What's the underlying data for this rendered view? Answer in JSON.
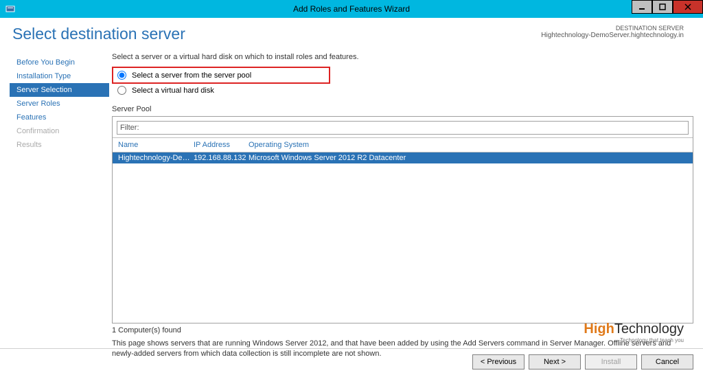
{
  "titlebar": {
    "title": "Add Roles and Features Wizard"
  },
  "header": {
    "pageTitle": "Select destination server",
    "destLabel": "DESTINATION SERVER",
    "destValue": "Hightechnology-DemoServer.hightechnology.in"
  },
  "nav": {
    "items": [
      {
        "label": "Before You Begin",
        "state": "link"
      },
      {
        "label": "Installation Type",
        "state": "link"
      },
      {
        "label": "Server Selection",
        "state": "selected"
      },
      {
        "label": "Server Roles",
        "state": "link"
      },
      {
        "label": "Features",
        "state": "link"
      },
      {
        "label": "Confirmation",
        "state": "disabled"
      },
      {
        "label": "Results",
        "state": "disabled"
      }
    ]
  },
  "main": {
    "instruction": "Select a server or a virtual hard disk on which to install roles and features.",
    "radio": {
      "pool": "Select a server from the server pool",
      "vhd": "Select a virtual hard disk"
    },
    "poolHeader": "Server Pool",
    "filterLabel": "Filter:",
    "filterValue": "",
    "columns": {
      "name": "Name",
      "ip": "IP Address",
      "os": "Operating System"
    },
    "rows": [
      {
        "name": "Hightechnology-DemoS...",
        "ip": "192.168.88.132",
        "os": "Microsoft Windows Server 2012 R2 Datacenter"
      }
    ],
    "count": "1 Computer(s) found",
    "note": "This page shows servers that are running Windows Server 2012, and that have been added by using the Add Servers command in Server Manager. Offline servers and newly-added servers from which data collection is still incomplete are not shown."
  },
  "footer": {
    "previous": "< Previous",
    "next": "Next >",
    "install": "Install",
    "cancel": "Cancel"
  },
  "watermark": {
    "hi": "High",
    "rest": "Technology",
    "sub": "Technology that teach you"
  }
}
